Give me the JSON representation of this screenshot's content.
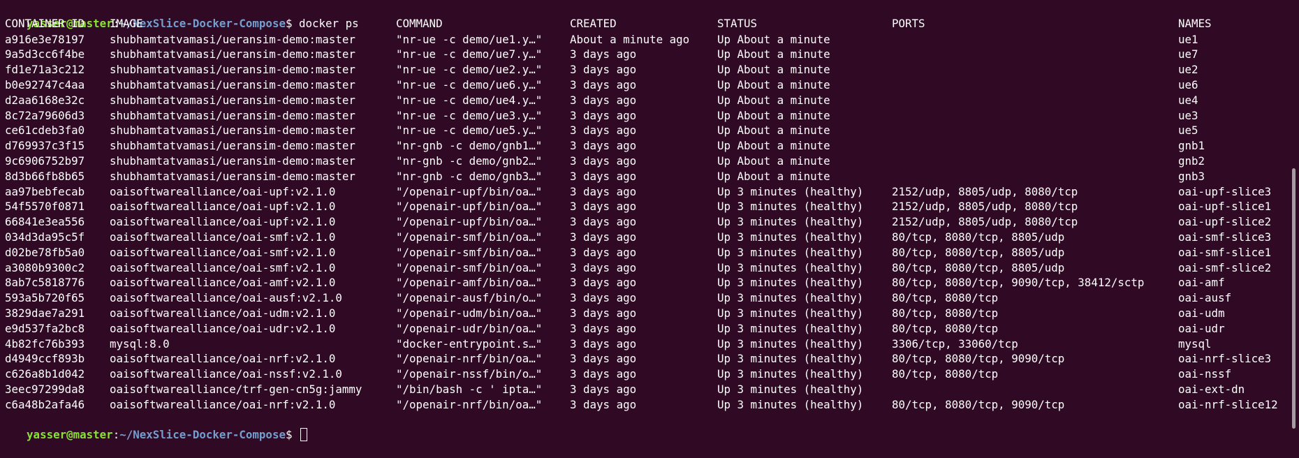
{
  "terminal": {
    "prompt": {
      "user_host": "yasser@master",
      "separator": ":",
      "path": "~/NexSlice-Docker-Compose",
      "symbol": "$ ",
      "command": "docker ps"
    },
    "headers": [
      "CONTAINER ID",
      "IMAGE",
      "COMMAND",
      "CREATED",
      "STATUS",
      "PORTS",
      "NAMES"
    ],
    "rows": [
      [
        "a916e3e78197",
        "shubhamtatvamasi/ueransim-demo:master",
        "\"nr-ue -c demo/ue1.y…\"",
        "About a minute ago",
        "Up About a minute",
        "",
        "ue1"
      ],
      [
        "9a5d3cc6f4be",
        "shubhamtatvamasi/ueransim-demo:master",
        "\"nr-ue -c demo/ue7.y…\"",
        "3 days ago",
        "Up About a minute",
        "",
        "ue7"
      ],
      [
        "fd1e71a3c212",
        "shubhamtatvamasi/ueransim-demo:master",
        "\"nr-ue -c demo/ue2.y…\"",
        "3 days ago",
        "Up About a minute",
        "",
        "ue2"
      ],
      [
        "b0e92747c4aa",
        "shubhamtatvamasi/ueransim-demo:master",
        "\"nr-ue -c demo/ue6.y…\"",
        "3 days ago",
        "Up About a minute",
        "",
        "ue6"
      ],
      [
        "d2aa6168e32c",
        "shubhamtatvamasi/ueransim-demo:master",
        "\"nr-ue -c demo/ue4.y…\"",
        "3 days ago",
        "Up About a minute",
        "",
        "ue4"
      ],
      [
        "8c72a79606d3",
        "shubhamtatvamasi/ueransim-demo:master",
        "\"nr-ue -c demo/ue3.y…\"",
        "3 days ago",
        "Up About a minute",
        "",
        "ue3"
      ],
      [
        "ce61cdeb3fa0",
        "shubhamtatvamasi/ueransim-demo:master",
        "\"nr-ue -c demo/ue5.y…\"",
        "3 days ago",
        "Up About a minute",
        "",
        "ue5"
      ],
      [
        "d769937c3f15",
        "shubhamtatvamasi/ueransim-demo:master",
        "\"nr-gnb -c demo/gnb1…\"",
        "3 days ago",
        "Up About a minute",
        "",
        "gnb1"
      ],
      [
        "9c6906752b97",
        "shubhamtatvamasi/ueransim-demo:master",
        "\"nr-gnb -c demo/gnb2…\"",
        "3 days ago",
        "Up About a minute",
        "",
        "gnb2"
      ],
      [
        "8d3b66fb8b65",
        "shubhamtatvamasi/ueransim-demo:master",
        "\"nr-gnb -c demo/gnb3…\"",
        "3 days ago",
        "Up About a minute",
        "",
        "gnb3"
      ],
      [
        "aa97bebfecab",
        "oaisoftwarealliance/oai-upf:v2.1.0",
        "\"/openair-upf/bin/oa…\"",
        "3 days ago",
        "Up 3 minutes (healthy)",
        "2152/udp, 8805/udp, 8080/tcp",
        "oai-upf-slice3"
      ],
      [
        "54f5570f0871",
        "oaisoftwarealliance/oai-upf:v2.1.0",
        "\"/openair-upf/bin/oa…\"",
        "3 days ago",
        "Up 3 minutes (healthy)",
        "2152/udp, 8805/udp, 8080/tcp",
        "oai-upf-slice1"
      ],
      [
        "66841e3ea556",
        "oaisoftwarealliance/oai-upf:v2.1.0",
        "\"/openair-upf/bin/oa…\"",
        "3 days ago",
        "Up 3 minutes (healthy)",
        "2152/udp, 8805/udp, 8080/tcp",
        "oai-upf-slice2"
      ],
      [
        "034d3da95c5f",
        "oaisoftwarealliance/oai-smf:v2.1.0",
        "\"/openair-smf/bin/oa…\"",
        "3 days ago",
        "Up 3 minutes (healthy)",
        "80/tcp, 8080/tcp, 8805/udp",
        "oai-smf-slice3"
      ],
      [
        "d02be78fb5a0",
        "oaisoftwarealliance/oai-smf:v2.1.0",
        "\"/openair-smf/bin/oa…\"",
        "3 days ago",
        "Up 3 minutes (healthy)",
        "80/tcp, 8080/tcp, 8805/udp",
        "oai-smf-slice1"
      ],
      [
        "a3080b9300c2",
        "oaisoftwarealliance/oai-smf:v2.1.0",
        "\"/openair-smf/bin/oa…\"",
        "3 days ago",
        "Up 3 minutes (healthy)",
        "80/tcp, 8080/tcp, 8805/udp",
        "oai-smf-slice2"
      ],
      [
        "8ab7c5818776",
        "oaisoftwarealliance/oai-amf:v2.1.0",
        "\"/openair-amf/bin/oa…\"",
        "3 days ago",
        "Up 3 minutes (healthy)",
        "80/tcp, 8080/tcp, 9090/tcp, 38412/sctp",
        "oai-amf"
      ],
      [
        "593a5b720f65",
        "oaisoftwarealliance/oai-ausf:v2.1.0",
        "\"/openair-ausf/bin/o…\"",
        "3 days ago",
        "Up 3 minutes (healthy)",
        "80/tcp, 8080/tcp",
        "oai-ausf"
      ],
      [
        "3829dae7a291",
        "oaisoftwarealliance/oai-udm:v2.1.0",
        "\"/openair-udm/bin/oa…\"",
        "3 days ago",
        "Up 3 minutes (healthy)",
        "80/tcp, 8080/tcp",
        "oai-udm"
      ],
      [
        "e9d537fa2bc8",
        "oaisoftwarealliance/oai-udr:v2.1.0",
        "\"/openair-udr/bin/oa…\"",
        "3 days ago",
        "Up 3 minutes (healthy)",
        "80/tcp, 8080/tcp",
        "oai-udr"
      ],
      [
        "4b82fc76b393",
        "mysql:8.0",
        "\"docker-entrypoint.s…\"",
        "3 days ago",
        "Up 3 minutes (healthy)",
        "3306/tcp, 33060/tcp",
        "mysql"
      ],
      [
        "d4949ccf893b",
        "oaisoftwarealliance/oai-nrf:v2.1.0",
        "\"/openair-nrf/bin/oa…\"",
        "3 days ago",
        "Up 3 minutes (healthy)",
        "80/tcp, 8080/tcp, 9090/tcp",
        "oai-nrf-slice3"
      ],
      [
        "c626a8b1d042",
        "oaisoftwarealliance/oai-nssf:v2.1.0",
        "\"/openair-nssf/bin/o…\"",
        "3 days ago",
        "Up 3 minutes (healthy)",
        "80/tcp, 8080/tcp",
        "oai-nssf"
      ],
      [
        "3eec97299da8",
        "oaisoftwarealliance/trf-gen-cn5g:jammy",
        "\"/bin/bash -c ' ipta…\"",
        "3 days ago",
        "Up 3 minutes (healthy)",
        "",
        "oai-ext-dn"
      ],
      [
        "c6a48b2afa46",
        "oaisoftwarealliance/oai-nrf:v2.1.0",
        "\"/openair-nrf/bin/oa…\"",
        "3 days ago",
        "Up 3 minutes (healthy)",
        "80/tcp, 8080/tcp, 9090/tcp",
        "oai-nrf-slice12"
      ]
    ],
    "colors": {
      "background": "#300a24",
      "user_host": "#8ae234",
      "path": "#729fcf",
      "text": "#ffffff"
    }
  }
}
